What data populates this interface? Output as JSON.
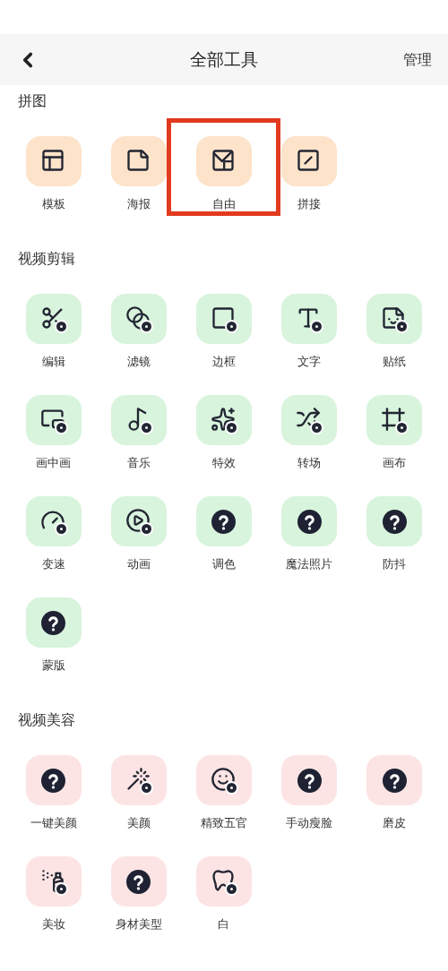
{
  "header": {
    "title": "全部工具",
    "action": "管理"
  },
  "sections": [
    {
      "title": "拼图",
      "color": "#fde3c9",
      "items": [
        {
          "label": "模板",
          "highlighted": false
        },
        {
          "label": "海报",
          "highlighted": false
        },
        {
          "label": "自由",
          "highlighted": true
        },
        {
          "label": "拼接",
          "highlighted": false
        }
      ]
    },
    {
      "title": "视频剪辑",
      "color": "#d8f4dc",
      "items": [
        {
          "label": "编辑",
          "highlighted": false
        },
        {
          "label": "滤镜",
          "highlighted": false
        },
        {
          "label": "边框",
          "highlighted": false
        },
        {
          "label": "文字",
          "highlighted": false
        },
        {
          "label": "贴纸",
          "highlighted": false
        },
        {
          "label": "画中画",
          "highlighted": false
        },
        {
          "label": "音乐",
          "highlighted": false
        },
        {
          "label": "特效",
          "highlighted": false
        },
        {
          "label": "转场",
          "highlighted": false
        },
        {
          "label": "画布",
          "highlighted": false
        },
        {
          "label": "变速",
          "highlighted": false
        },
        {
          "label": "动画",
          "highlighted": false
        },
        {
          "label": "调色",
          "highlighted": false
        },
        {
          "label": "魔法照片",
          "highlighted": false
        },
        {
          "label": "防抖",
          "highlighted": false
        },
        {
          "label": "蒙版",
          "highlighted": false
        }
      ]
    },
    {
      "title": "视频美容",
      "color": "#fde4e4",
      "items": [
        {
          "label": "一键美颜",
          "highlighted": false
        },
        {
          "label": "美颜",
          "highlighted": false
        },
        {
          "label": "精致五官",
          "highlighted": false
        },
        {
          "label": "手动瘦脸",
          "highlighted": false
        },
        {
          "label": "磨皮",
          "highlighted": false
        },
        {
          "label": "美妆",
          "highlighted": false
        },
        {
          "label": "身材美型",
          "highlighted": false
        },
        {
          "label": "白",
          "highlighted": false
        }
      ]
    }
  ]
}
